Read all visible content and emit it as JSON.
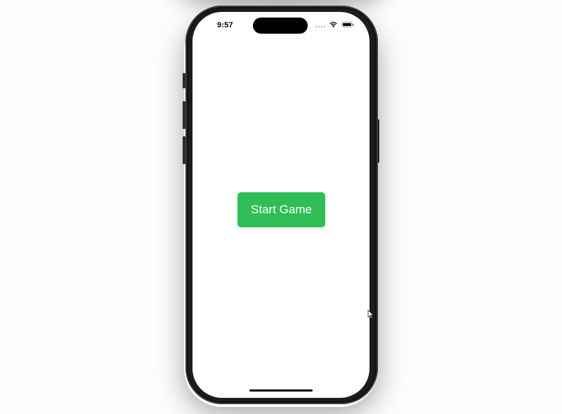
{
  "status_bar": {
    "time": "9:57",
    "signal_icon": "signal-dots-icon",
    "wifi_icon": "wifi-icon",
    "battery_icon": "battery-icon",
    "battery_level": 1.0
  },
  "main": {
    "start_button_label": "Start Game",
    "start_button_color": "#2fbe56"
  },
  "colors": {
    "screen_background": "#ffffff",
    "device_frame": "#1c1c1e",
    "page_background": "#fdfdfd"
  }
}
